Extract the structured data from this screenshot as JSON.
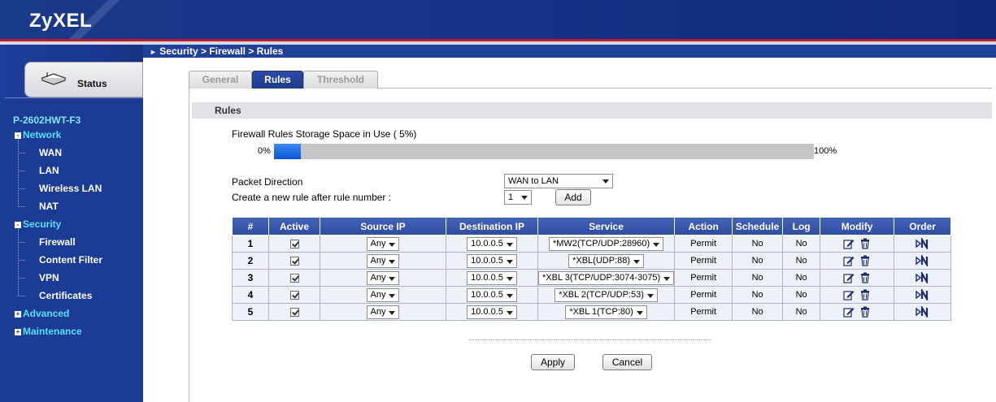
{
  "header": {
    "logo": "ZyXEL"
  },
  "breadcrumb": "Security > Firewall > Rules",
  "sidebar": {
    "status_label": "Status",
    "device_name": "P-2602HWT-F3",
    "network": {
      "label": "Network",
      "toggle": "-",
      "items": [
        "WAN",
        "LAN",
        "Wireless LAN",
        "NAT"
      ]
    },
    "security": {
      "label": "Security",
      "toggle": "-",
      "items": [
        "Firewall",
        "Content Filter",
        "VPN",
        "Certificates"
      ]
    },
    "advanced": {
      "label": "Advanced",
      "toggle": "+"
    },
    "maintenance": {
      "label": "Maintenance",
      "toggle": "+"
    }
  },
  "tabs": [
    {
      "label": "General",
      "active": false
    },
    {
      "label": "Rules",
      "active": true
    },
    {
      "label": "Threshold",
      "active": false
    }
  ],
  "section_title": "Rules",
  "storage": {
    "label": "Firewall Rules Storage Space in Use  ( 5%)",
    "min_label": "0%",
    "max_label": "100%",
    "fill_percent": 5
  },
  "packet_direction": {
    "label": "Packet Direction",
    "value": "WAN to LAN"
  },
  "new_rule": {
    "label": "Create a new rule after rule number :",
    "value": "1",
    "add_label": "Add"
  },
  "table": {
    "headers": [
      "#",
      "Active",
      "Source IP",
      "Destination IP",
      "Service",
      "Action",
      "Schedule",
      "Log",
      "Modify",
      "Order"
    ],
    "rows": [
      {
        "num": "1",
        "source": "Any",
        "dest": "10.0.0.5",
        "service": "*MW2(TCP/UDP:28960)",
        "action": "Permit",
        "schedule": "No",
        "log": "No"
      },
      {
        "num": "2",
        "source": "Any",
        "dest": "10.0.0.5",
        "service": "*XBL(UDP:88)",
        "action": "Permit",
        "schedule": "No",
        "log": "No"
      },
      {
        "num": "3",
        "source": "Any",
        "dest": "10.0.0.5",
        "service": "*XBL 3(TCP/UDP:3074-3075)",
        "action": "Permit",
        "schedule": "No",
        "log": "No"
      },
      {
        "num": "4",
        "source": "Any",
        "dest": "10.0.0.5",
        "service": "*XBL 2(TCP/UDP:53)",
        "action": "Permit",
        "schedule": "No",
        "log": "No"
      },
      {
        "num": "5",
        "source": "Any",
        "dest": "10.0.0.5",
        "service": "*XBL 1(TCP:80)",
        "action": "Permit",
        "schedule": "No",
        "log": "No"
      }
    ]
  },
  "buttons": {
    "apply": "Apply",
    "cancel": "Cancel"
  },
  "colors": {
    "header_blue": "#1a3a8a",
    "accent_red": "#c0192e",
    "menu_cyan": "#55e0ff",
    "table_header": "#3556ad",
    "progress_fill": "#0b54d6"
  }
}
